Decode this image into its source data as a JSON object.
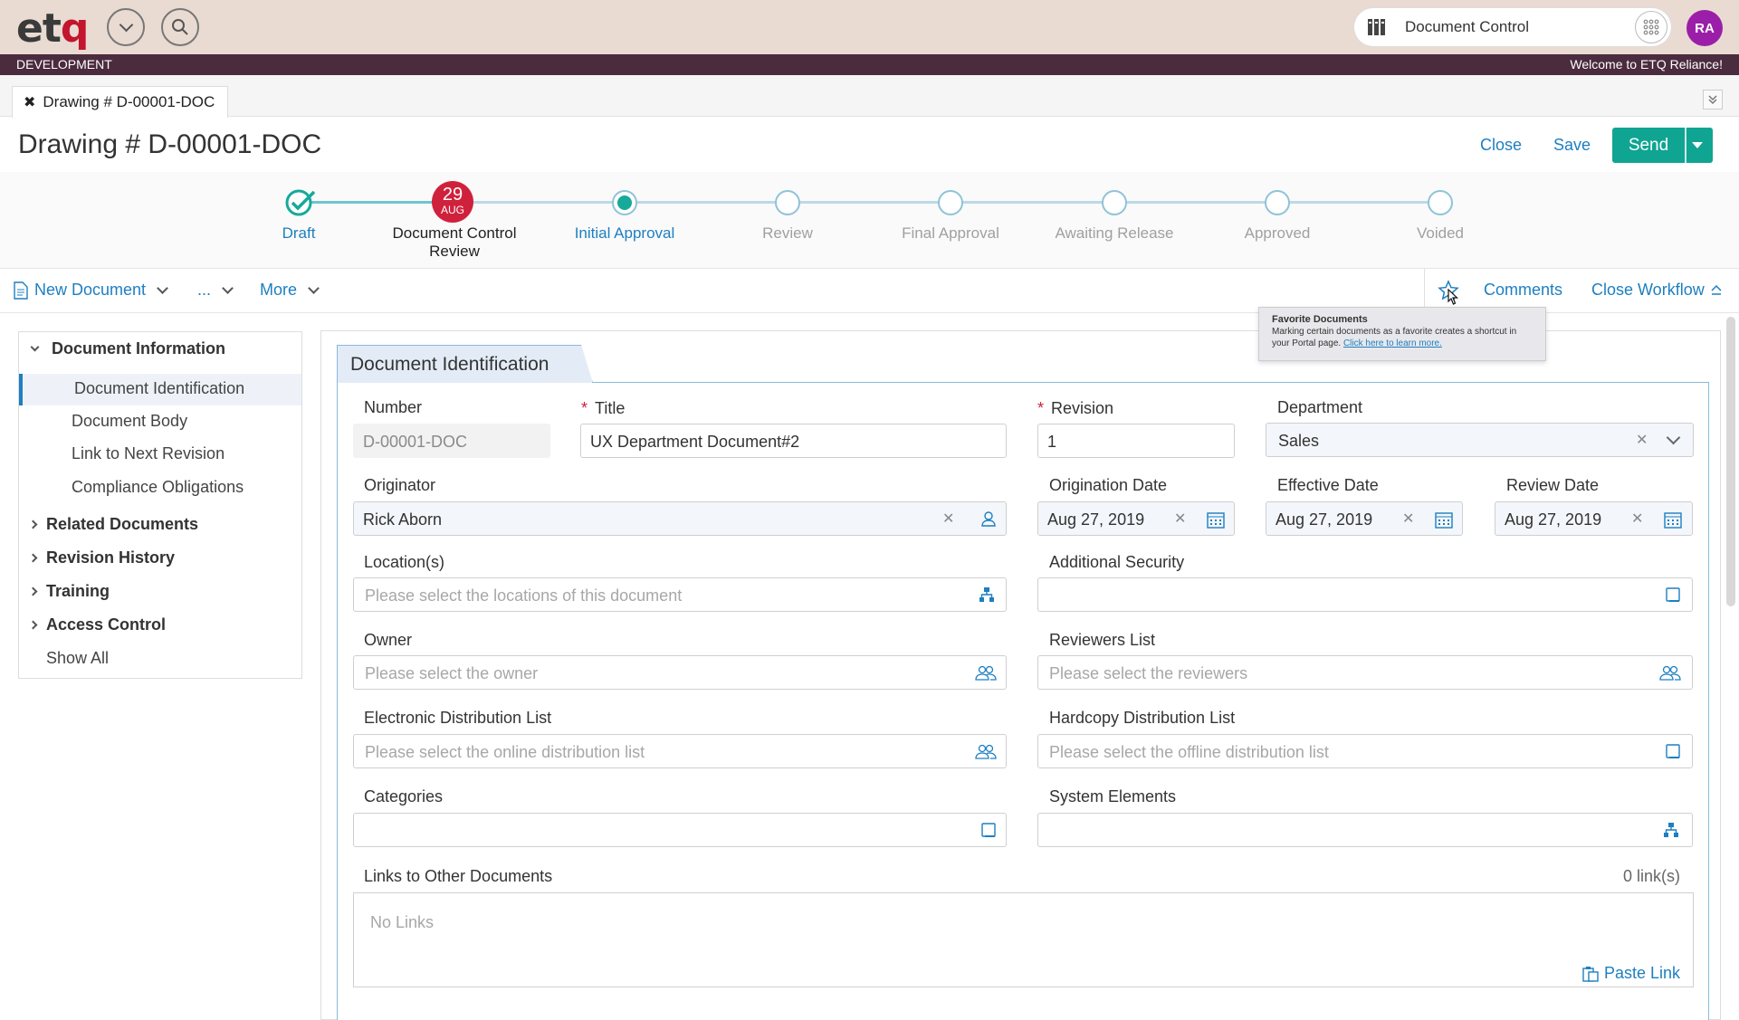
{
  "topbar": {
    "logo_main": "et",
    "logo_accent": "q",
    "app_name": "Document Control",
    "avatar_initials": "RA"
  },
  "envbar": {
    "environment": "DEVELOPMENT",
    "welcome": "Welcome to ETQ Reliance!"
  },
  "tabs": {
    "active_tab": "Drawing # D-00001-DOC",
    "close_glyph": "✖"
  },
  "header": {
    "title": "Drawing # D-00001-DOC",
    "close_label": "Close",
    "save_label": "Save",
    "send_label": "Send"
  },
  "workflow": {
    "date_badge": {
      "day": "29",
      "month": "AUG"
    },
    "steps": [
      {
        "label": "Draft",
        "state": "done"
      },
      {
        "label": "Document Control Review",
        "state": "current"
      },
      {
        "label": "Initial Approval",
        "state": "next"
      },
      {
        "label": "Review",
        "state": "pending"
      },
      {
        "label": "Final Approval",
        "state": "pending"
      },
      {
        "label": "Awaiting Release",
        "state": "pending"
      },
      {
        "label": "Approved",
        "state": "pending"
      },
      {
        "label": "Voided",
        "state": "pending"
      }
    ]
  },
  "toolbar": {
    "new_document": "New Document",
    "ellipsis": "...",
    "more": "More",
    "comments": "Comments",
    "close_workflow": "Close Workflow"
  },
  "tooltip": {
    "title": "Favorite Documents",
    "body": "Marking certain documents as a favorite creates a shortcut in your Portal page.",
    "link": "Click here to learn more."
  },
  "sidenav": {
    "sections": [
      {
        "label": "Document Information",
        "expanded": true
      },
      {
        "label": "Related Documents",
        "expanded": false
      },
      {
        "label": "Revision History",
        "expanded": false
      },
      {
        "label": "Training",
        "expanded": false
      },
      {
        "label": "Access Control",
        "expanded": false
      }
    ],
    "subitems": [
      "Document Identification",
      "Document Body",
      "Link to Next Revision",
      "Compliance Obligations"
    ],
    "show_all": "Show All"
  },
  "form": {
    "tab_title": "Document Identification",
    "number": {
      "label": "Number",
      "value": "D-00001-DOC"
    },
    "title": {
      "label": "Title",
      "value": "UX Department Document#2",
      "required": true
    },
    "revision": {
      "label": "Revision",
      "value": "1",
      "required": true
    },
    "department": {
      "label": "Department",
      "value": "Sales"
    },
    "originator": {
      "label": "Originator",
      "value": "Rick Aborn"
    },
    "origination_date": {
      "label": "Origination Date",
      "value": "Aug 27, 2019"
    },
    "effective_date": {
      "label": "Effective Date",
      "value": "Aug 27, 2019"
    },
    "review_date": {
      "label": "Review Date",
      "value": "Aug 27, 2019"
    },
    "locations": {
      "label": "Location(s)",
      "placeholder": "Please select the locations of this document"
    },
    "additional_security": {
      "label": "Additional Security",
      "placeholder": ""
    },
    "owner": {
      "label": "Owner",
      "placeholder": "Please select the owner"
    },
    "reviewers": {
      "label": "Reviewers List",
      "placeholder": "Please select the reviewers"
    },
    "electronic_distribution": {
      "label": "Electronic Distribution List",
      "placeholder": "Please select the online distribution list"
    },
    "hardcopy_distribution": {
      "label": "Hardcopy Distribution List",
      "placeholder": "Please select the offline distribution list"
    },
    "categories": {
      "label": "Categories",
      "placeholder": ""
    },
    "system_elements": {
      "label": "System Elements",
      "placeholder": ""
    },
    "links": {
      "label": "Links to Other Documents",
      "count": "0 link(s)",
      "empty": "No Links",
      "paste_label": "Paste Link"
    }
  },
  "colors": {
    "brand_red": "#c4152e",
    "accent_blue": "#1d7fc0",
    "send_teal": "#0fa592",
    "env_bar": "#4b2b3e",
    "badge_red": "#d0213c",
    "avatar_purple": "#9b1ea8"
  }
}
